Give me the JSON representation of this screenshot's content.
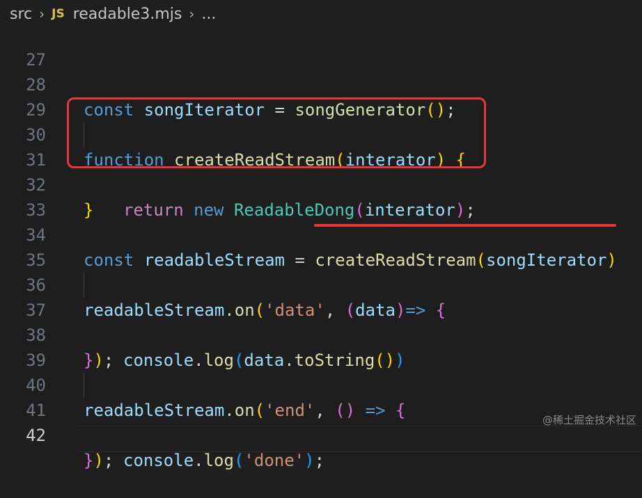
{
  "breadcrumb": {
    "folder": "src",
    "file_badge": "JS",
    "file": "readable3.mjs",
    "more": "..."
  },
  "editor": {
    "line_numbers": [
      "27",
      "28",
      "29",
      "30",
      "31",
      "32",
      "33",
      "34",
      "35",
      "36",
      "37",
      "38",
      "39",
      "40",
      "41",
      "42"
    ],
    "active_line": "42",
    "tokens": {
      "l28": [
        "const",
        " ",
        "songIterator",
        " = ",
        "songGenerator",
        "()",
        ";"
      ],
      "l30": [
        "function",
        " ",
        "createReadStream",
        "(",
        "interator",
        ")",
        " ",
        "{"
      ],
      "l31": [
        "return",
        " ",
        "new",
        " ",
        "ReadableDong",
        "(",
        "interator",
        ")",
        ";"
      ],
      "l32": [
        "}"
      ],
      "l34": [
        "const",
        " ",
        "readableStream",
        " = ",
        "createReadStream",
        "(",
        "songIterator",
        ")"
      ],
      "l36": [
        "readableStream",
        ".",
        "on",
        "(",
        "'data'",
        ", ",
        "(",
        "data",
        ")",
        "=>",
        " ",
        "{"
      ],
      "l37": [
        "console",
        ".",
        "log",
        "(",
        "data",
        ".",
        "toString",
        "()",
        ")"
      ],
      "l38": [
        "}",
        ")",
        ";"
      ],
      "l40": [
        "readableStream",
        ".",
        "on",
        "(",
        "'end'",
        ", ",
        "()",
        " => ",
        "{"
      ],
      "l41": [
        "console",
        ".",
        "log",
        "(",
        "'done'",
        ")",
        ";"
      ],
      "l42": [
        "}",
        ")",
        ";"
      ]
    }
  },
  "annotations": {
    "box_color": "#e8373c",
    "underline_color": "#e8373c"
  },
  "watermark": "@稀土掘金技术社区"
}
